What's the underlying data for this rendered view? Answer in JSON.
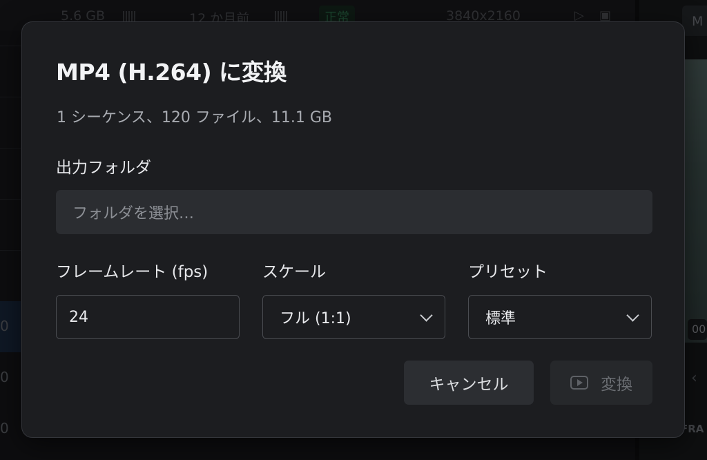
{
  "background": {
    "row_size": "5.6 GB",
    "row_age": "12 か月前",
    "row_status": "正常",
    "row_resolution": "3840x2160",
    "left_numbers": [
      "0",
      "0",
      "0"
    ],
    "right_tab_label": "M",
    "timecode": "00",
    "right_label": "FRA"
  },
  "dialog": {
    "title": "MP4 (H.264) に変換",
    "summary": "1 シーケンス、120 ファイル、11.1 GB",
    "output_folder": {
      "label": "出力フォルダ",
      "placeholder": "フォルダを選択…"
    },
    "framerate": {
      "label": "フレームレート (fps)",
      "value": "24"
    },
    "scale": {
      "label": "スケール",
      "value": "フル (1:1)"
    },
    "preset": {
      "label": "プリセット",
      "value": "標準"
    },
    "cancel_label": "キャンセル",
    "convert_label": "変換"
  },
  "colors": {
    "dialog_bg": "#1c1d20",
    "field_bg": "#2b2d31",
    "status_green": "#2a6a48"
  }
}
